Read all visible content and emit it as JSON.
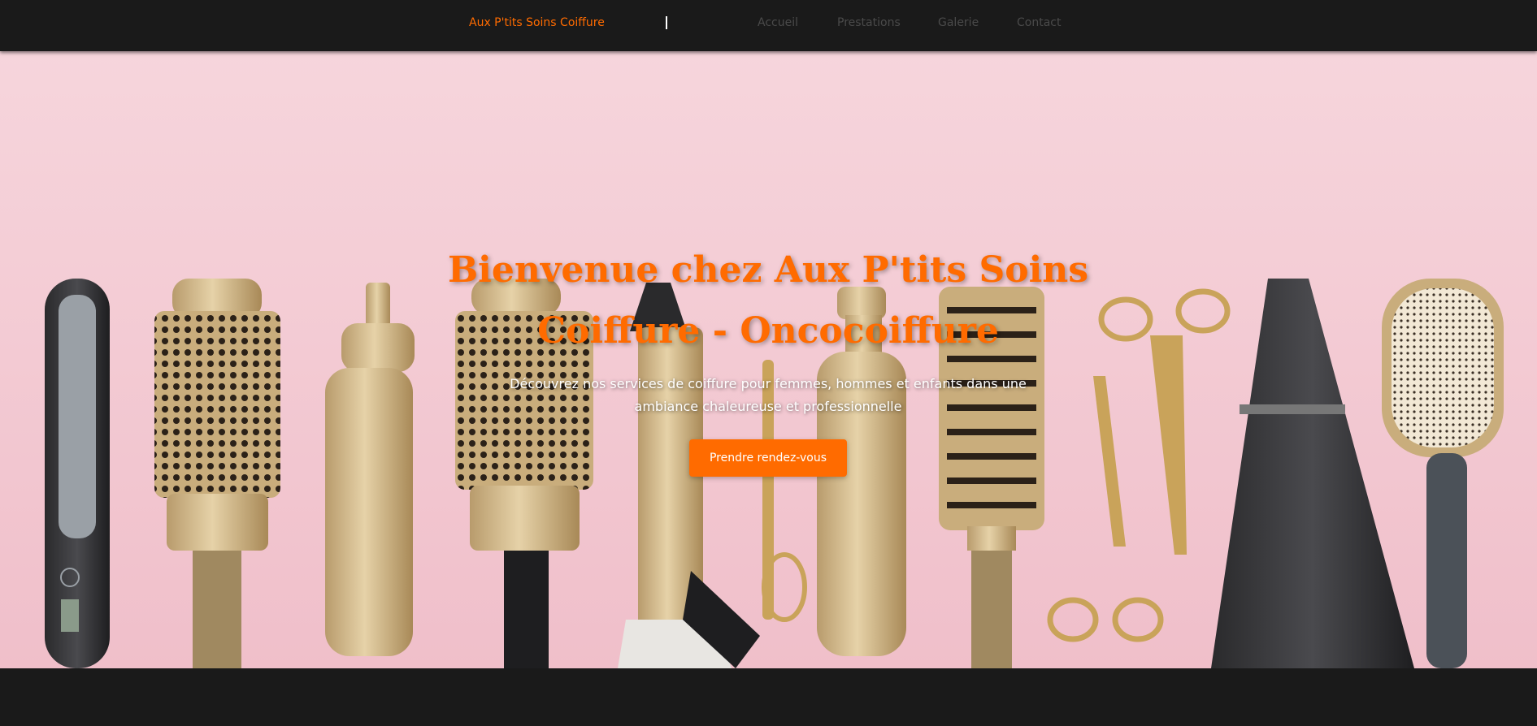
{
  "nav": {
    "brand": "Aux P'tits Soins Coiffure",
    "links": [
      "Accueil",
      "Prestations",
      "Galerie",
      "Contact"
    ]
  },
  "hero": {
    "title_line1": "Bienvenue chez Aux P'tits Soins",
    "title_line2": "Coiffure - Oncocoiffure",
    "subtitle": "Découvrez nos services de coiffure pour femmes, hommes et enfants dans une ambiance chaleureuse et professionnelle",
    "cta_label": "Prendre rendez-vous",
    "background_image": "hair-tools-photo"
  },
  "colors": {
    "accent": "#ff6b00",
    "nav_bg": "#1a1a1a",
    "nav_link": "#4a4a4a",
    "hero_bg": "#f5d1d8"
  }
}
